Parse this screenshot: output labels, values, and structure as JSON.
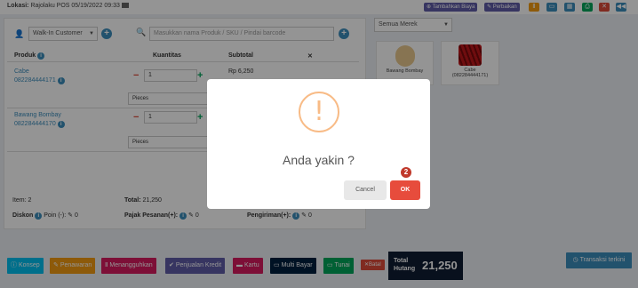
{
  "topbar": {
    "lokasi_label": "Lokasi:",
    "lokasi_value": "Rajolaku POS",
    "datetime": "05/19/2022 09:33",
    "tambahkan_biaya": "Tambahkan Biaya",
    "perbaikan": "Perbaikan"
  },
  "customer": {
    "value": "Walk-In Customer"
  },
  "search": {
    "placeholder": "Masukkan nama Produk / SKU / Pindai barcode"
  },
  "table": {
    "headers": {
      "produk": "Produk",
      "kuantitas": "Kuantitas",
      "subtotal": "Subtotal",
      "remove": "✕"
    },
    "rows": [
      {
        "name": "Cabe",
        "code": "082284444171",
        "qty": "1",
        "unit": "Pieces",
        "subtotal": "Rp 6,250"
      },
      {
        "name": "Bawang Bombay",
        "code": "082284444170",
        "qty": "1",
        "unit": "Pieces",
        "subtotal": ""
      }
    ]
  },
  "summary": {
    "item_label": "Item:",
    "item_value": "2",
    "total_label": "Total:",
    "total_value": "21,250",
    "diskon_label": "Diskon",
    "poin_label": "Poin (-):",
    "poin_value": "0",
    "pajak_label": "Pajak Pesanan(+):",
    "pajak_value": "0",
    "pengiriman_label": "Pengiriman(+):",
    "pengiriman_value": "0"
  },
  "brand_filter": {
    "value": "Semua Merek"
  },
  "products": [
    {
      "name": "Bawang Bombay",
      "code": ""
    },
    {
      "name": "Cabe",
      "code": "(082284444171)"
    }
  ],
  "bottom_bar": {
    "konsep": "Konsep",
    "penawaran": "Penawaran",
    "menangguhkan": "Menangguhkan",
    "penjualan_kredit": "Penjualan Kredit",
    "kartu": "Kartu",
    "multi_bayar": "Multi Bayar",
    "tunai": "Tunai",
    "batal": "Batal",
    "total_hutang_label_1": "Total",
    "total_hutang_label_2": "Hutang",
    "total_hutang_value": "21,250",
    "transaksi_terkini": "Transaksi terkini"
  },
  "modal": {
    "title": "Anda yakin ?",
    "icon": "!",
    "cancel": "Cancel",
    "ok": "OK",
    "badge": "2"
  },
  "colors": {
    "primary": "#3c8dbc",
    "success": "#00a65a",
    "danger": "#dd4b39",
    "warning": "#f39c12",
    "modal_ok": "#e74c3c",
    "dark_total": "#0f1c33"
  }
}
